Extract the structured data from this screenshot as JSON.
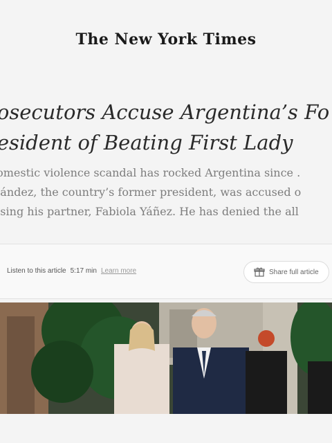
{
  "masthead": "The New York Times",
  "headline": {
    "line1": "rosecutors Accuse Argentina’s Fo",
    "line2": "resident of Beating First Lady"
  },
  "summary": {
    "line1": "lomestic violence scandal has rocked Argentina since .",
    "line2": "nández, the country’s former president, was accused o",
    "line3": "using his partner, Fabiola Yáñez. He has denied the all"
  },
  "toolbar": {
    "listen_label": "Listen to this article",
    "duration": "5:17 min",
    "learn_more": "Learn more",
    "share_label": "Share full article"
  },
  "colors": {
    "background": "#f4f4f4",
    "headline": "#2a2a2a",
    "summary": "#7d7d7d"
  },
  "icons": {
    "share": "gift-icon"
  }
}
